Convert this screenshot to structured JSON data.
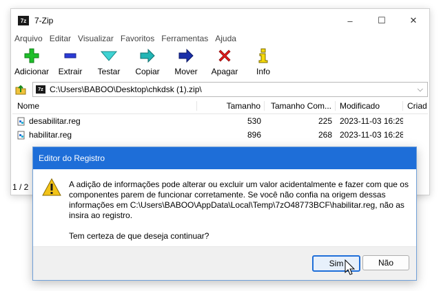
{
  "window": {
    "title": "7-Zip",
    "app_icon_text": "7z",
    "controls": {
      "minimize": "–",
      "maximize": "☐",
      "close": "✕"
    }
  },
  "menu": [
    "Arquivo",
    "Editar",
    "Visualizar",
    "Favoritos",
    "Ferramentas",
    "Ajuda"
  ],
  "toolbar": {
    "add": "Adicionar",
    "extract": "Extrair",
    "test": "Testar",
    "copy": "Copiar",
    "move": "Mover",
    "delete": "Apagar",
    "info": "Info"
  },
  "address": {
    "path": "C:\\Users\\BABOO\\Desktop\\chkdsk (1).zip\\",
    "zip_icon_text": "7z",
    "dropdown": "⌵"
  },
  "list": {
    "columns": {
      "name": "Nome",
      "size": "Tamanho",
      "packed": "Tamanho Com...",
      "modified": "Modificado",
      "created": "Criad"
    },
    "rows": [
      {
        "name": "desabilitar.reg",
        "size": "530",
        "packed": "225",
        "modified": "2023-11-03 16:29"
      },
      {
        "name": "habilitar.reg",
        "size": "896",
        "packed": "268",
        "modified": "2023-11-03 16:28"
      }
    ]
  },
  "status": {
    "left": "1 / 2"
  },
  "dialog": {
    "title": "Editor do Registro",
    "message": "A adição de informações pode alterar ou excluir um valor acidentalmente e fazer com que os componentes parem de funcionar corretamente. Se você não confia na origem dessas informações em C:\\Users\\BABOO\\AppData\\Local\\Temp\\7zO48773BCF\\habilitar.reg, não as insira ao registro.",
    "question": "Tem certeza de que deseja continuar?",
    "yes": "Sim",
    "no": "Não"
  },
  "colors": {
    "accent": "#1e6ed8",
    "warning": "#f2c318",
    "delete_red": "#e11b1b",
    "add_green": "#1fbf2a"
  }
}
